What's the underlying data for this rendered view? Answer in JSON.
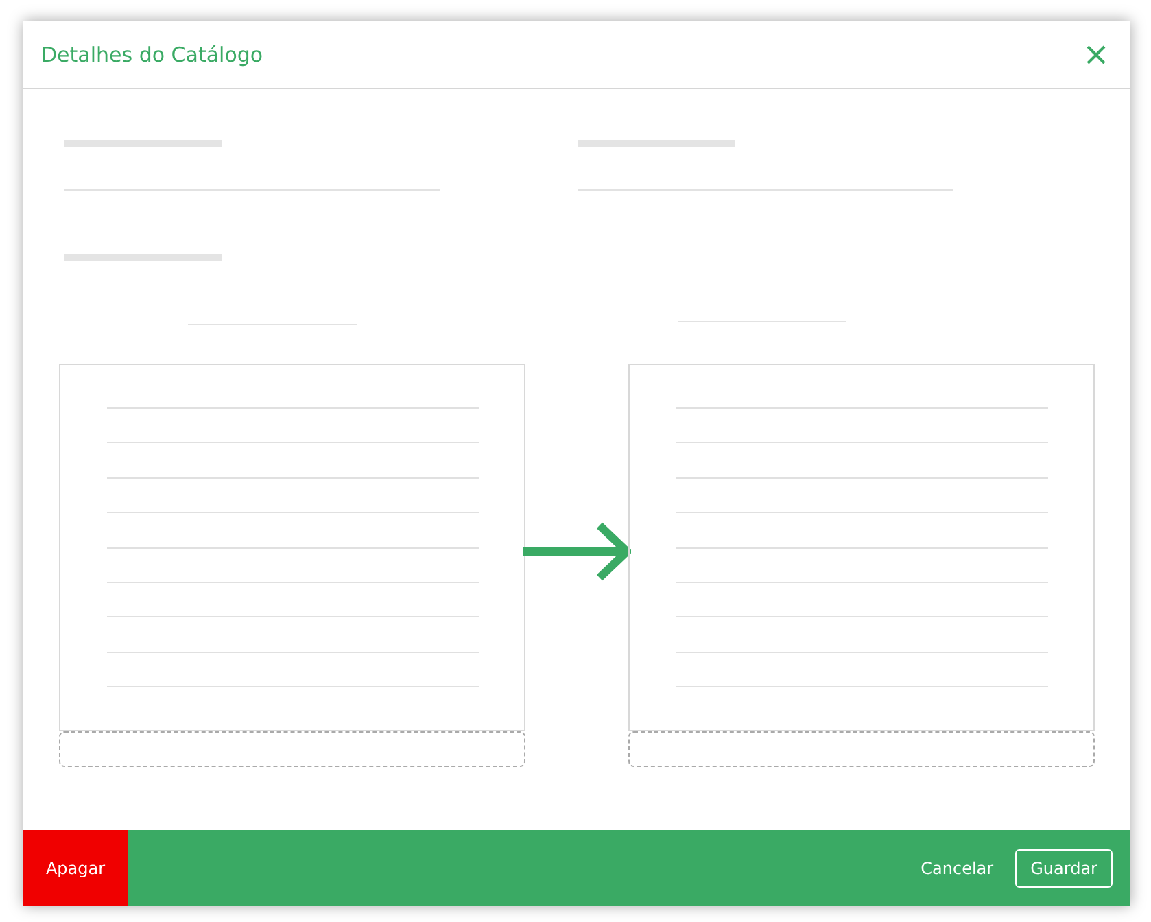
{
  "dialog": {
    "title": "Detalhes do Catálogo"
  },
  "footer": {
    "buttons": [
      {
        "kind": "danger",
        "label": "Apagar"
      },
      {
        "kind": "link",
        "label": "Cancelar"
      },
      {
        "kind": "outline",
        "label": "Guardar"
      }
    ]
  }
}
